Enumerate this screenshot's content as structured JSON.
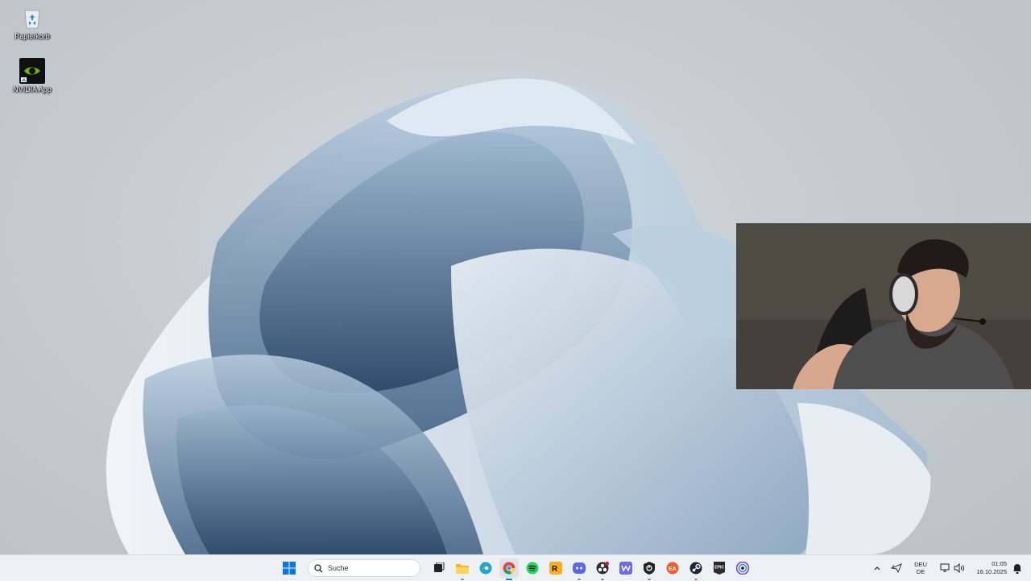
{
  "desktop": {
    "icons": [
      {
        "label": "Papierkorb",
        "icon": "recycle-bin-icon"
      },
      {
        "label": "NVIDIA App",
        "icon": "nvidia-icon"
      }
    ]
  },
  "webcam": {
    "description_icon": "webcam-overlay"
  },
  "taskbar": {
    "search_placeholder": "Suche",
    "apps": [
      "start-icon",
      "task-view-icon",
      "file-explorer-icon",
      "edge-icon",
      "chrome-icon",
      "spotify-icon",
      "rockstar-icon",
      "discord-icon",
      "obs-icon",
      "warp-icon",
      "shield-app-icon",
      "ea-icon",
      "steam-icon",
      "epic-games-icon",
      "ubisoft-icon"
    ],
    "tray": {
      "lang_top": "DEU",
      "lang_bottom": "DE",
      "time": "01:05",
      "date": "16.10.2025"
    }
  },
  "colors": {
    "accent": "#0078d4",
    "taskbar_bg": "#eef1f4"
  }
}
